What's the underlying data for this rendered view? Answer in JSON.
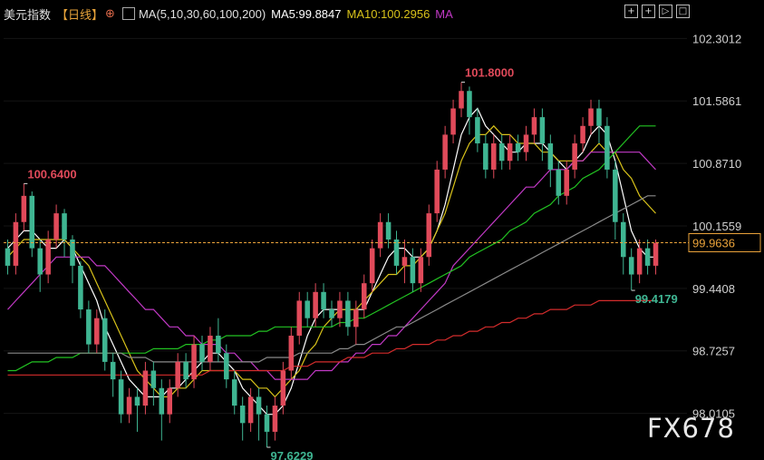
{
  "header": {
    "instrument": "美元指数",
    "period": "【日线】",
    "period_icon": "crosshair-icon",
    "ma_icon": "indicator-chart-icon",
    "ma_setting": "MA(5,10,30,60,100,200)",
    "ma5_label": "MA5:99.8847",
    "ma10_label": "MA10:100.2956",
    "ma_label": "MA"
  },
  "toolbar": [
    {
      "name": "crosshair-tool",
      "glyph": "+"
    },
    {
      "name": "zoom-in-tool",
      "glyph": "+"
    },
    {
      "name": "play-tool",
      "glyph": "▷"
    },
    {
      "name": "expand-tool",
      "glyph": "□"
    }
  ],
  "watermark": "FX678",
  "colors": {
    "bg": "#000000",
    "up": "#e04a5a",
    "down": "#3fb592",
    "ma5": "#ffffff",
    "ma10": "#d8c21a",
    "ma30": "#c239c6",
    "ma60": "#22c222",
    "ma100": "#8a8a8a",
    "ma200": "#d42c2c",
    "current_line": "#e9a23a",
    "high_label": "#e04a5a",
    "low_label": "#3fb592"
  },
  "chart_data": {
    "type": "candlestick",
    "y_axis_ticks": [
      102.3012,
      101.5861,
      100.871,
      100.1559,
      99.4408,
      98.7257,
      98.0105
    ],
    "ylim": [
      97.55,
      102.45
    ],
    "current_price": 99.9636,
    "annotations": [
      {
        "text": "101.8000",
        "value": 101.8,
        "type": "high"
      },
      {
        "text": "100.6400",
        "value": 100.64,
        "type": "high"
      },
      {
        "text": "99.4179",
        "value": 99.4179,
        "type": "low"
      },
      {
        "text": "97.6229",
        "value": 97.6229,
        "type": "low"
      }
    ],
    "candles": [
      [
        99.9,
        99.7,
        100.0,
        99.6
      ],
      [
        99.7,
        100.2,
        100.3,
        99.6
      ],
      [
        100.2,
        100.5,
        100.64,
        100.1
      ],
      [
        100.5,
        99.9,
        100.55,
        99.8
      ],
      [
        99.9,
        99.6,
        100.0,
        99.4
      ],
      [
        99.6,
        100.0,
        100.1,
        99.5
      ],
      [
        100.0,
        100.3,
        100.4,
        99.9
      ],
      [
        100.3,
        100.0,
        100.35,
        99.8
      ],
      [
        100.0,
        99.7,
        100.05,
        99.5
      ],
      [
        99.7,
        99.2,
        99.75,
        99.1
      ],
      [
        99.2,
        98.8,
        99.3,
        98.7
      ],
      [
        98.8,
        99.1,
        99.2,
        98.7
      ],
      [
        99.1,
        98.6,
        99.2,
        98.5
      ],
      [
        98.6,
        98.4,
        98.7,
        98.2
      ],
      [
        98.4,
        98.0,
        98.5,
        97.9
      ],
      [
        98.0,
        98.2,
        98.3,
        97.9
      ],
      [
        98.2,
        98.1,
        98.3,
        97.8
      ],
      [
        98.1,
        98.5,
        98.6,
        98.0
      ],
      [
        98.5,
        98.3,
        98.6,
        98.1
      ],
      [
        98.3,
        98.0,
        98.4,
        97.7
      ],
      [
        98.0,
        98.3,
        98.4,
        97.9
      ],
      [
        98.3,
        98.6,
        98.7,
        98.2
      ],
      [
        98.6,
        98.4,
        98.7,
        98.3
      ],
      [
        98.4,
        98.8,
        98.9,
        98.3
      ],
      [
        98.8,
        98.6,
        98.9,
        98.5
      ],
      [
        98.6,
        98.9,
        99.0,
        98.5
      ],
      [
        98.9,
        98.7,
        99.1,
        98.6
      ],
      [
        98.7,
        98.4,
        98.8,
        98.3
      ],
      [
        98.4,
        98.1,
        98.5,
        98.0
      ],
      [
        98.1,
        97.9,
        98.2,
        97.7
      ],
      [
        97.9,
        98.2,
        98.3,
        97.8
      ],
      [
        98.2,
        98.0,
        98.3,
        97.7
      ],
      [
        98.0,
        97.8,
        98.1,
        97.623
      ],
      [
        97.8,
        98.1,
        98.2,
        97.7
      ],
      [
        98.1,
        98.5,
        98.6,
        98.0
      ],
      [
        98.5,
        98.9,
        99.0,
        98.4
      ],
      [
        98.9,
        99.3,
        99.4,
        98.8
      ],
      [
        99.3,
        99.1,
        99.4,
        99.0
      ],
      [
        99.1,
        99.4,
        99.5,
        99.0
      ],
      [
        99.4,
        99.2,
        99.5,
        99.1
      ],
      [
        99.2,
        99.1,
        99.3,
        99.0
      ],
      [
        99.1,
        99.3,
        99.4,
        99.0
      ],
      [
        99.3,
        99.0,
        99.4,
        98.9
      ],
      [
        99.0,
        99.2,
        99.3,
        98.8
      ],
      [
        99.2,
        99.5,
        99.6,
        99.1
      ],
      [
        99.5,
        99.9,
        100.0,
        99.4
      ],
      [
        99.9,
        100.2,
        100.3,
        99.8
      ],
      [
        100.2,
        100.0,
        100.3,
        99.9
      ],
      [
        100.0,
        99.7,
        100.1,
        99.6
      ],
      [
        99.7,
        99.8,
        100.0,
        99.5
      ],
      [
        99.8,
        99.5,
        99.9,
        99.4
      ],
      [
        99.5,
        99.8,
        99.9,
        99.4
      ],
      [
        99.8,
        100.3,
        100.4,
        99.7
      ],
      [
        100.3,
        100.8,
        100.9,
        100.2
      ],
      [
        100.8,
        101.2,
        101.3,
        100.7
      ],
      [
        101.2,
        101.5,
        101.6,
        101.1
      ],
      [
        101.5,
        101.7,
        101.8,
        101.4
      ],
      [
        101.7,
        101.4,
        101.75,
        101.2
      ],
      [
        101.4,
        101.1,
        101.5,
        101.0
      ],
      [
        101.1,
        100.8,
        101.2,
        100.7
      ],
      [
        100.8,
        101.1,
        101.2,
        100.7
      ],
      [
        101.1,
        100.9,
        101.2,
        100.8
      ],
      [
        100.9,
        101.1,
        101.2,
        100.8
      ],
      [
        101.1,
        101.0,
        101.2,
        100.9
      ],
      [
        101.0,
        101.2,
        101.3,
        100.9
      ],
      [
        101.2,
        101.4,
        101.5,
        101.1
      ],
      [
        101.4,
        101.1,
        101.5,
        100.9
      ],
      [
        101.1,
        100.8,
        101.2,
        100.6
      ],
      [
        100.8,
        100.5,
        100.9,
        100.4
      ],
      [
        100.5,
        100.8,
        100.9,
        100.4
      ],
      [
        100.8,
        101.1,
        101.2,
        100.7
      ],
      [
        101.1,
        101.3,
        101.4,
        101.0
      ],
      [
        101.3,
        101.5,
        101.6,
        101.2
      ],
      [
        101.5,
        101.3,
        101.6,
        101.1
      ],
      [
        101.3,
        100.8,
        101.4,
        100.7
      ],
      [
        100.8,
        100.2,
        100.9,
        100.0
      ],
      [
        100.2,
        99.8,
        100.3,
        99.6
      ],
      [
        99.8,
        99.6,
        99.9,
        99.418
      ],
      [
        99.6,
        99.9,
        100.0,
        99.5
      ],
      [
        99.9,
        99.7,
        100.0,
        99.6
      ],
      [
        99.7,
        99.96,
        100.0,
        99.6
      ]
    ],
    "ma_series": [
      {
        "name": "MA5",
        "key": "ma5",
        "values": [
          99.9,
          100.0,
          100.1,
          100.1,
          100.0,
          99.9,
          99.9,
          100.0,
          99.9,
          99.7,
          99.5,
          99.3,
          99.0,
          98.8,
          98.6,
          98.4,
          98.3,
          98.2,
          98.2,
          98.2,
          98.3,
          98.3,
          98.4,
          98.5,
          98.6,
          98.7,
          98.7,
          98.6,
          98.5,
          98.3,
          98.2,
          98.1,
          98.0,
          98.0,
          98.1,
          98.3,
          98.6,
          98.9,
          99.1,
          99.2,
          99.2,
          99.2,
          99.2,
          99.2,
          99.2,
          99.4,
          99.6,
          99.8,
          99.9,
          99.9,
          99.8,
          99.8,
          99.9,
          100.1,
          100.4,
          100.8,
          101.2,
          101.4,
          101.5,
          101.3,
          101.2,
          101.1,
          101.0,
          101.0,
          101.1,
          101.1,
          101.1,
          101.0,
          100.9,
          100.8,
          100.9,
          101.0,
          101.2,
          101.3,
          101.2,
          100.9,
          100.5,
          100.1,
          99.9,
          99.8,
          99.8
        ]
      },
      {
        "name": "MA10",
        "key": "ma10",
        "values": [
          99.8,
          99.9,
          100.0,
          100.0,
          100.0,
          100.0,
          100.0,
          100.0,
          99.9,
          99.8,
          99.7,
          99.5,
          99.3,
          99.1,
          98.9,
          98.7,
          98.5,
          98.4,
          98.3,
          98.2,
          98.2,
          98.3,
          98.3,
          98.4,
          98.5,
          98.5,
          98.5,
          98.5,
          98.5,
          98.4,
          98.4,
          98.3,
          98.3,
          98.2,
          98.3,
          98.4,
          98.5,
          98.7,
          98.8,
          99.0,
          99.1,
          99.2,
          99.2,
          99.2,
          99.3,
          99.4,
          99.5,
          99.6,
          99.6,
          99.7,
          99.7,
          99.8,
          99.9,
          100.1,
          100.3,
          100.6,
          100.9,
          101.1,
          101.2,
          101.2,
          101.3,
          101.2,
          101.2,
          101.1,
          101.1,
          101.1,
          101.0,
          101.0,
          100.9,
          100.9,
          100.9,
          100.9,
          101.0,
          101.1,
          101.0,
          101.0,
          100.8,
          100.7,
          100.5,
          100.4,
          100.3
        ]
      },
      {
        "name": "MA30",
        "key": "ma30",
        "values": [
          99.2,
          99.3,
          99.4,
          99.5,
          99.6,
          99.7,
          99.8,
          99.8,
          99.8,
          99.8,
          99.8,
          99.7,
          99.7,
          99.6,
          99.5,
          99.4,
          99.3,
          99.2,
          99.2,
          99.1,
          99.0,
          99.0,
          98.9,
          98.9,
          98.8,
          98.8,
          98.8,
          98.7,
          98.7,
          98.6,
          98.6,
          98.5,
          98.5,
          98.4,
          98.4,
          98.4,
          98.4,
          98.4,
          98.5,
          98.5,
          98.5,
          98.6,
          98.6,
          98.7,
          98.7,
          98.8,
          98.8,
          98.9,
          98.9,
          99.0,
          99.1,
          99.2,
          99.3,
          99.4,
          99.5,
          99.7,
          99.8,
          99.9,
          100.0,
          100.1,
          100.2,
          100.3,
          100.4,
          100.5,
          100.6,
          100.6,
          100.7,
          100.8,
          100.8,
          100.8,
          100.9,
          100.9,
          101.0,
          101.0,
          101.0,
          101.0,
          101.0,
          101.0,
          101.0,
          100.9,
          100.8
        ]
      },
      {
        "name": "MA60",
        "key": "ma60",
        "values": [
          98.5,
          98.5,
          98.55,
          98.6,
          98.6,
          98.6,
          98.65,
          98.65,
          98.65,
          98.7,
          98.7,
          98.7,
          98.7,
          98.7,
          98.7,
          98.7,
          98.7,
          98.7,
          98.75,
          98.75,
          98.75,
          98.75,
          98.8,
          98.8,
          98.8,
          98.85,
          98.85,
          98.9,
          98.9,
          98.9,
          98.9,
          98.95,
          98.95,
          99.0,
          99.0,
          99.0,
          99.0,
          99.0,
          99.0,
          99.0,
          99.0,
          99.05,
          99.05,
          99.1,
          99.1,
          99.15,
          99.2,
          99.25,
          99.3,
          99.35,
          99.4,
          99.45,
          99.5,
          99.55,
          99.6,
          99.65,
          99.7,
          99.8,
          99.85,
          99.9,
          99.95,
          100.0,
          100.1,
          100.15,
          100.2,
          100.3,
          100.35,
          100.4,
          100.5,
          100.55,
          100.6,
          100.7,
          100.75,
          100.8,
          100.9,
          101.0,
          101.1,
          101.2,
          101.3,
          101.3,
          101.3
        ]
      },
      {
        "name": "MA100",
        "key": "ma100",
        "values": [
          98.7,
          98.7,
          98.7,
          98.7,
          98.7,
          98.7,
          98.7,
          98.7,
          98.7,
          98.7,
          98.7,
          98.7,
          98.7,
          98.7,
          98.7,
          98.65,
          98.65,
          98.65,
          98.6,
          98.6,
          98.6,
          98.6,
          98.6,
          98.6,
          98.6,
          98.6,
          98.6,
          98.6,
          98.6,
          98.6,
          98.6,
          98.6,
          98.65,
          98.65,
          98.65,
          98.65,
          98.7,
          98.7,
          98.7,
          98.7,
          98.7,
          98.75,
          98.75,
          98.8,
          98.8,
          98.85,
          98.9,
          98.95,
          99.0,
          99.0,
          99.05,
          99.1,
          99.15,
          99.2,
          99.25,
          99.3,
          99.35,
          99.4,
          99.45,
          99.5,
          99.55,
          99.6,
          99.65,
          99.7,
          99.75,
          99.8,
          99.85,
          99.9,
          99.95,
          100.0,
          100.05,
          100.1,
          100.15,
          100.2,
          100.25,
          100.3,
          100.35,
          100.4,
          100.45,
          100.5,
          100.5
        ]
      },
      {
        "name": "MA200",
        "key": "ma200",
        "values": [
          98.45,
          98.45,
          98.45,
          98.45,
          98.45,
          98.45,
          98.45,
          98.45,
          98.45,
          98.45,
          98.45,
          98.45,
          98.45,
          98.45,
          98.45,
          98.45,
          98.45,
          98.45,
          98.45,
          98.45,
          98.45,
          98.45,
          98.45,
          98.45,
          98.45,
          98.5,
          98.5,
          98.5,
          98.5,
          98.5,
          98.5,
          98.5,
          98.5,
          98.5,
          98.5,
          98.55,
          98.55,
          98.55,
          98.6,
          98.6,
          98.6,
          98.6,
          98.65,
          98.65,
          98.65,
          98.7,
          98.7,
          98.7,
          98.75,
          98.75,
          98.8,
          98.8,
          98.8,
          98.85,
          98.85,
          98.9,
          98.9,
          98.95,
          98.95,
          99.0,
          99.0,
          99.05,
          99.05,
          99.1,
          99.1,
          99.15,
          99.15,
          99.2,
          99.2,
          99.2,
          99.25,
          99.25,
          99.25,
          99.3,
          99.3,
          99.3,
          99.3,
          99.3,
          99.3,
          99.3,
          99.3
        ]
      }
    ]
  }
}
